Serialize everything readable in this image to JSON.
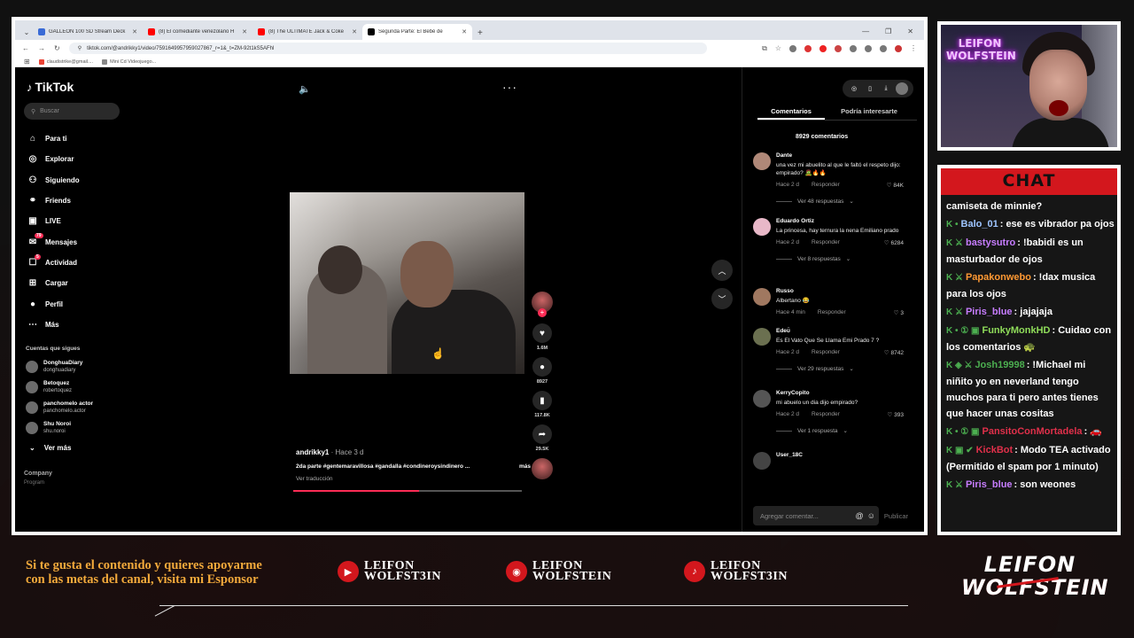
{
  "browser": {
    "tabs": [
      {
        "label": "GALLEON 100 SD Stream Deck",
        "color": "#3a6bd6",
        "active": false
      },
      {
        "label": "(8) El comediante venezolano H",
        "color": "#ff0000",
        "active": false
      },
      {
        "label": "(8) The ULTIMATE Jack & Coke",
        "color": "#ff0000",
        "active": false
      },
      {
        "label": "Segunda Parte: El Bebé de",
        "color": "#000000",
        "active": true
      }
    ],
    "url": "tiktok.com/@andrikky1/video/7591649957959027867_r=1&_t=ZM-92t1kS5AFhl",
    "bookmarks": [
      {
        "label": "claudistrike@gmail....",
        "color": "#ea4335"
      },
      {
        "label": "Mini Cd Videojuego...",
        "color": "#888888"
      }
    ]
  },
  "tiktok": {
    "logo": "TikTok",
    "search_placeholder": "Buscar",
    "nav": [
      {
        "label": "Para ti",
        "icon": "home-icon",
        "glyph": "⌂"
      },
      {
        "label": "Explorar",
        "icon": "compass-icon",
        "glyph": "◎"
      },
      {
        "label": "Siguiendo",
        "icon": "user-follow-icon",
        "glyph": "⚇"
      },
      {
        "label": "Friends",
        "icon": "friends-icon",
        "glyph": "⚭"
      },
      {
        "label": "LIVE",
        "icon": "live-icon",
        "glyph": "▣"
      },
      {
        "label": "Mensajes",
        "icon": "messages-icon",
        "glyph": "✉",
        "badge": "79"
      },
      {
        "label": "Actividad",
        "icon": "activity-icon",
        "glyph": "☐",
        "badge": "5"
      },
      {
        "label": "Cargar",
        "icon": "upload-icon",
        "glyph": "⊞"
      },
      {
        "label": "Perfil",
        "icon": "profile-icon",
        "glyph": "●"
      },
      {
        "label": "Más",
        "icon": "more-icon",
        "glyph": "⋯"
      }
    ],
    "following_title": "Cuentas que sigues",
    "following": [
      {
        "name": "DonghuaDiary",
        "handle": "donghuadiary"
      },
      {
        "name": "Betoquez",
        "handle": "robertoquez"
      },
      {
        "name": "panchomelo actor",
        "handle": "panchomelo.actor"
      },
      {
        "name": "Shu Noroi",
        "handle": "shu.noroi"
      }
    ],
    "see_more": "Ver más",
    "footer_company": "Company",
    "footer_program": "Program",
    "video": {
      "author": "andrikky1",
      "time": " · Hace 3 d",
      "description": "2da parte #gentemaravillosa #gandalla #condineroysindinero ...",
      "more": "más",
      "translate": "Ver traducción",
      "progress": 0.55
    },
    "actions": [
      {
        "icon": "heart-icon",
        "glyph": "♥",
        "count": "1.6M"
      },
      {
        "icon": "comment-icon",
        "glyph": "●",
        "count": "8927"
      },
      {
        "icon": "bookmark-icon",
        "glyph": "▮",
        "count": "117.8K"
      },
      {
        "icon": "share-icon",
        "glyph": "➦",
        "count": "29.5K"
      }
    ],
    "comments_panel": {
      "tab_comments": "Comentarios",
      "tab_interest": "Podría interesarte",
      "count": "8929 comentarios",
      "comments": [
        {
          "name": "Dante",
          "text": "una vez mi abuelito al que le faltó el respeto dijo: empirado? 🧟🔥🔥",
          "time": "Hace 2 d",
          "reply": "Responder",
          "likes": "84K",
          "replies": "Ver 48 respuestas",
          "color": "#b08878"
        },
        {
          "name": "Eduardo Ortiz",
          "text": "La princesa, hay ternura la nena Emiliano prado",
          "time": "Hace 2 d",
          "reply": "Responder",
          "likes": "6284",
          "replies": "Ver 8 respuestas",
          "color": "#e8b8c8"
        },
        {
          "name": "Russo",
          "text": "Albertano 😂",
          "time": "Hace 4 min",
          "reply": "Responder",
          "likes": "3",
          "replies": "",
          "color": "#a07860"
        },
        {
          "name": "Edeʊ̈",
          "text": "Es El Vato Que Se Llama Emi Prado 7 ?",
          "time": "Hace 2 d",
          "reply": "Responder",
          "likes": "8742",
          "replies": "Ver 29 respuestas",
          "color": "#6b7050"
        },
        {
          "name": "KerryCopito",
          "text": "mi abuelo un dia dijo empirado?",
          "time": "Hace 2 d",
          "reply": "Responder",
          "likes": "393",
          "replies": "Ver 1 respuesta",
          "color": "#555555"
        },
        {
          "name": "User_18C",
          "text": "",
          "time": "",
          "reply": "",
          "likes": "",
          "replies": "",
          "color": "#444444"
        }
      ],
      "input_placeholder": "Agregar comentar...",
      "publish": "Publicar"
    }
  },
  "overlay": {
    "cam_neon_text": "LEIFON WOLFSTEIN",
    "chat_title": "CHAT",
    "chat": [
      {
        "user": "",
        "user_color": "#ffffff",
        "icons": "",
        "text": "camiseta de minnie?"
      },
      {
        "user": "Balo_01",
        "user_color": "#9ec5ff",
        "icons": "K •",
        "text": ": ese es vibrador pa ojos"
      },
      {
        "user": "bastysutro",
        "user_color": "#c77dff",
        "icons": "K ⚔",
        "text": ": !babidi es un masturbador de ojos"
      },
      {
        "user": "Papakonwebo",
        "user_color": "#ff9933",
        "icons": "K ⚔",
        "text": ": !dax musica para los ojos"
      },
      {
        "user": "Piris_blue",
        "user_color": "#c77dff",
        "icons": "K ⚔",
        "text": ": jajajaja"
      },
      {
        "user": "FunkyMonkHD",
        "user_color": "#8fdc5a",
        "icons": "K • ① ▣",
        "text": ": Cuidao con los comentarios 🐢"
      },
      {
        "user": "Josh19998",
        "user_color": "#4caf50",
        "icons": "K ◈ ⚔",
        "text": ": !Michael mi niñito yo en neverland tengo muchos para ti pero antes tienes que hacer unas cositas"
      },
      {
        "user": "PansitoConMortadela",
        "user_color": "#e0304a",
        "icons": "K • ① ▣",
        "text": ": 🚗"
      },
      {
        "user": "KickBot",
        "user_color": "#e0304a",
        "icons": "K ▣ ✔",
        "text": ": Modo TEA activado (Permitido el spam por 1 minuto)"
      },
      {
        "user": "Piris_blue",
        "user_color": "#c77dff",
        "icons": "K ⚔",
        "text": ": son weones"
      }
    ],
    "sponsor_text": "Si te gusta el contenido y quieres apoyarme con las metas del canal, visita mi Esponsor",
    "socials": [
      {
        "icon": "youtube-icon",
        "glyph": "▶",
        "line1": "LEIFON",
        "line2": "WOLFST3IN"
      },
      {
        "icon": "instagram-icon",
        "glyph": "◉",
        "line1": "LEIFON",
        "line2": "WOLFSTEIN"
      },
      {
        "icon": "tiktok-icon",
        "glyph": "♪",
        "line1": "LEIFON",
        "line2": "WOLFST3IN"
      }
    ],
    "brand_line1": "LEIFON",
    "brand_line2": "WOLFSTEIN",
    "accent": "#d3171d",
    "sponsor_color": "#f2a93b"
  }
}
